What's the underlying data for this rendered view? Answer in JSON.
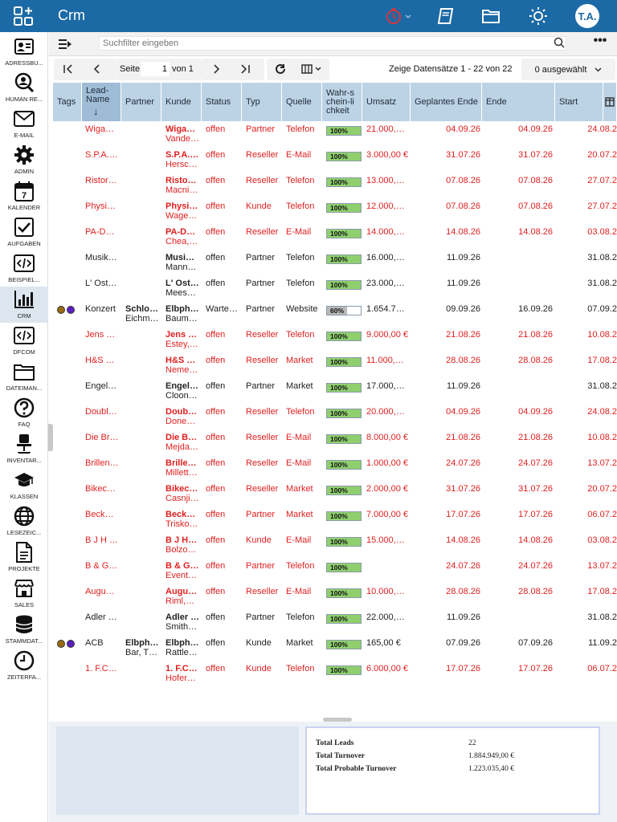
{
  "app": {
    "title": "Crm",
    "user_initials": "T.A."
  },
  "colors": {
    "header_bg": "#1b6aa5",
    "row_red": "#e02020",
    "row_black": "#222222",
    "progress_fill": "#8fcf6e",
    "header_grid": "#bcd3e6"
  },
  "sidebar": [
    {
      "label": "ADRESSBU...",
      "icon": "address-book-icon"
    },
    {
      "label": "HUMAN RE...",
      "icon": "person-search-icon"
    },
    {
      "label": "E-MAIL",
      "icon": "mail-icon"
    },
    {
      "label": "ADMIN",
      "icon": "gear-icon"
    },
    {
      "label": "KALENDER",
      "icon": "calendar-icon"
    },
    {
      "label": "AUFGABEN",
      "icon": "checkbox-icon"
    },
    {
      "label": "BEISPIEL...",
      "icon": "code-icon"
    },
    {
      "label": "CRM",
      "icon": "bar-chart-icon"
    },
    {
      "label": "DFCOM",
      "icon": "code-icon"
    },
    {
      "label": "DATEIMAN...",
      "icon": "folder-icon"
    },
    {
      "label": "FAQ",
      "icon": "question-icon"
    },
    {
      "label": "INVENTAR...",
      "icon": "chair-icon"
    },
    {
      "label": "KLASSEN",
      "icon": "graduation-cap-icon"
    },
    {
      "label": "LESEZEIC...",
      "icon": "globe-icon"
    },
    {
      "label": "PROJEKTE",
      "icon": "document-icon"
    },
    {
      "label": "SALES",
      "icon": "store-icon"
    },
    {
      "label": "STAMMDAT...",
      "icon": "database-icon"
    },
    {
      "label": "ZEITERFA...",
      "icon": "clock-icon"
    }
  ],
  "search": {
    "placeholder": "Suchfilter eingeben"
  },
  "pager": {
    "page_label": "Seite",
    "page_value": "1",
    "of_label": "von 1",
    "records_text": "Zeige Datensätze 1 - 22 von 22",
    "selected_text": "0 ausgewählt"
  },
  "columns": [
    "Tags",
    "Lead-Name",
    "Partner",
    "Kunde",
    "Status",
    "Typ",
    "Quelle",
    "Wahr-schein-lichkeit",
    "Umsatz",
    "Geplantes Ende",
    "Ende",
    "Start"
  ],
  "rows": [
    {
      "red": true,
      "tags": [],
      "lead": "Wiga…",
      "partner": "",
      "kunde1": "Wiga…",
      "kunde2": "Vande…",
      "status": "offen",
      "typ": "Partner",
      "quelle": "Telefon",
      "prob_pct": 100,
      "prob_label": "100%",
      "umsatz": "21.000,…",
      "geplant": "04.09.26",
      "ende": "04.09.26",
      "start": "24.08.2"
    },
    {
      "red": true,
      "tags": [],
      "lead": "S.P.A.…",
      "partner": "",
      "kunde1": "S.P.A.…",
      "kunde2": "Hersc…",
      "status": "offen",
      "typ": "Reseller",
      "quelle": "E-Mail",
      "prob_pct": 100,
      "prob_label": "100%",
      "umsatz": "3.000,00 €",
      "geplant": "31.07.26",
      "ende": "31.07.26",
      "start": "20.07.2"
    },
    {
      "red": true,
      "tags": [],
      "lead": "Ristor…",
      "partner": "",
      "kunde1": "Risto…",
      "kunde2": "Macni…",
      "status": "offen",
      "typ": "Reseller",
      "quelle": "Telefon",
      "prob_pct": 100,
      "prob_label": "100%",
      "umsatz": "13.000,…",
      "geplant": "07.08.26",
      "ende": "07.08.26",
      "start": "27.07.2"
    },
    {
      "red": true,
      "tags": [],
      "lead": "Physi…",
      "partner": "",
      "kunde1": "Physi…",
      "kunde2": "Wage…",
      "status": "offen",
      "typ": "Kunde",
      "quelle": "Telefon",
      "prob_pct": 100,
      "prob_label": "100%",
      "umsatz": "12.000,…",
      "geplant": "07.08.26",
      "ende": "07.08.26",
      "start": "27.07.2"
    },
    {
      "red": true,
      "tags": [],
      "lead": "PA-D…",
      "partner": "",
      "kunde1": "PA-D…",
      "kunde2": "Chea,…",
      "status": "offen",
      "typ": "Reseller",
      "quelle": "E-Mail",
      "prob_pct": 100,
      "prob_label": "100%",
      "umsatz": "14.000,…",
      "geplant": "14.08.26",
      "ende": "14.08.26",
      "start": "03.08.2"
    },
    {
      "red": false,
      "tags": [],
      "lead": "Musik…",
      "partner": "",
      "kunde1": "Musi…",
      "kunde2": "Mann…",
      "status": "offen",
      "typ": "Partner",
      "quelle": "Telefon",
      "prob_pct": 100,
      "prob_label": "100%",
      "umsatz": "16.000,…",
      "geplant": "11.09.26",
      "ende": "",
      "start": "31.08.2"
    },
    {
      "red": false,
      "tags": [],
      "lead": "L' Ost…",
      "partner": "",
      "kunde1": "L' Ost…",
      "kunde2": "Mees…",
      "status": "offen",
      "typ": "Partner",
      "quelle": "Telefon",
      "prob_pct": 100,
      "prob_label": "100%",
      "umsatz": "23.000,…",
      "geplant": "11.09.26",
      "ende": "",
      "start": "31.08.2"
    },
    {
      "red": false,
      "tags": [
        "#9a6a10",
        "#5b1fc0"
      ],
      "lead": "Konzert",
      "partner": "Schlo…",
      "partner2": "Eichm…",
      "kunde1": "Elbph…",
      "kunde2": "Baum…",
      "status": "Warte…",
      "typ": "Partner",
      "quelle": "Website",
      "prob_pct": 60,
      "prob_label": "60%",
      "umsatz": "1.654.7…",
      "geplant": "09.09.26",
      "ende": "16.09.26",
      "start": "07.09.2"
    },
    {
      "red": true,
      "tags": [],
      "lead": "Jens …",
      "partner": "",
      "kunde1": "Jens …",
      "kunde2": "Estey,…",
      "status": "offen",
      "typ": "Reseller",
      "quelle": "Telefon",
      "prob_pct": 100,
      "prob_label": "100%",
      "umsatz": "9.000,00 €",
      "geplant": "21.08.26",
      "ende": "21.08.26",
      "start": "10.08.2"
    },
    {
      "red": true,
      "tags": [],
      "lead": "H&S …",
      "partner": "",
      "kunde1": "H&S …",
      "kunde2": "Neme…",
      "status": "offen",
      "typ": "Reseller",
      "quelle": "Market",
      "prob_pct": 100,
      "prob_label": "100%",
      "umsatz": "11.000,…",
      "geplant": "28.08.26",
      "ende": "28.08.26",
      "start": "17.08.2"
    },
    {
      "red": false,
      "tags": [],
      "lead": "Engel…",
      "partner": "",
      "kunde1": "Engel…",
      "kunde2": "Cloon…",
      "status": "offen",
      "typ": "Partner",
      "quelle": "Market",
      "prob_pct": 100,
      "prob_label": "100%",
      "umsatz": "17.000,…",
      "geplant": "11.09.26",
      "ende": "",
      "start": "31.08.2"
    },
    {
      "red": true,
      "tags": [],
      "lead": "Doubl…",
      "partner": "",
      "kunde1": "Doub…",
      "kunde2": "Done…",
      "status": "offen",
      "typ": "Reseller",
      "quelle": "Telefon",
      "prob_pct": 100,
      "prob_label": "100%",
      "umsatz": "20.000,…",
      "geplant": "04.09.26",
      "ende": "04.09.26",
      "start": "24.08.2"
    },
    {
      "red": true,
      "tags": [],
      "lead": "Die Br…",
      "partner": "",
      "kunde1": "Die B…",
      "kunde2": "Mejda…",
      "status": "offen",
      "typ": "Reseller",
      "quelle": "E-Mail",
      "prob_pct": 100,
      "prob_label": "100%",
      "umsatz": "8.000,00 €",
      "geplant": "21.08.26",
      "ende": "21.08.26",
      "start": "10.08.2"
    },
    {
      "red": true,
      "tags": [],
      "lead": "Brillen…",
      "partner": "",
      "kunde1": "Brille…",
      "kunde2": "Millett…",
      "status": "offen",
      "typ": "Reseller",
      "quelle": "E-Mail",
      "prob_pct": 100,
      "prob_label": "100%",
      "umsatz": "1.000,00 €",
      "geplant": "24.07.26",
      "ende": "24.07.26",
      "start": "13.07.2"
    },
    {
      "red": true,
      "tags": [],
      "lead": "Bikec…",
      "partner": "",
      "kunde1": "Bikec…",
      "kunde2": "Casnji…",
      "status": "offen",
      "typ": "Reseller",
      "quelle": "Market",
      "prob_pct": 100,
      "prob_label": "100%",
      "umsatz": "2.000,00 €",
      "geplant": "31.07.26",
      "ende": "31.07.26",
      "start": "20.07.2"
    },
    {
      "red": true,
      "tags": [],
      "lead": "Beck…",
      "partner": "",
      "kunde1": "Beck…",
      "kunde2": "Trisko…",
      "status": "offen",
      "typ": "Partner",
      "quelle": "Market",
      "prob_pct": 100,
      "prob_label": "100%",
      "umsatz": "7.000,00 €",
      "geplant": "17.07.26",
      "ende": "17.07.26",
      "start": "06.07.2"
    },
    {
      "red": true,
      "tags": [],
      "lead": "B J H …",
      "partner": "",
      "kunde1": "B J H…",
      "kunde2": "Bolzo…",
      "status": "offen",
      "typ": "Kunde",
      "quelle": "E-Mail",
      "prob_pct": 100,
      "prob_label": "100%",
      "umsatz": "15.000,…",
      "geplant": "14.08.26",
      "ende": "14.08.26",
      "start": "03.08.2"
    },
    {
      "red": true,
      "tags": [],
      "lead": "B & G…",
      "partner": "",
      "kunde1": "B & G…",
      "kunde2": "Event…",
      "status": "offen",
      "typ": "Partner",
      "quelle": "Telefon",
      "prob_pct": 100,
      "prob_label": "100%",
      "umsatz": "",
      "geplant": "24.07.26",
      "ende": "24.07.26",
      "start": "13.07.2"
    },
    {
      "red": true,
      "tags": [],
      "lead": "Augu…",
      "partner": "",
      "kunde1": "Augu…",
      "kunde2": "Riml,…",
      "status": "offen",
      "typ": "Reseller",
      "quelle": "E-Mail",
      "prob_pct": 100,
      "prob_label": "100%",
      "umsatz": "10.000,…",
      "geplant": "28.08.26",
      "ende": "28.08.26",
      "start": "17.08.2"
    },
    {
      "red": false,
      "tags": [],
      "lead": "Adler …",
      "partner": "",
      "kunde1": "Adler …",
      "kunde2": "Smith…",
      "status": "offen",
      "typ": "Partner",
      "quelle": "Telefon",
      "prob_pct": 100,
      "prob_label": "100%",
      "umsatz": "22.000,…",
      "geplant": "11.09.26",
      "ende": "",
      "start": "31.08.2"
    },
    {
      "red": false,
      "tags": [
        "#9a6a10",
        "#5b1fc0"
      ],
      "lead": "ACB",
      "partner": "Elbph…",
      "partner2": "Bar, T…",
      "kunde1": "Elbph…",
      "kunde2": "Rattle…",
      "status": "offen",
      "typ": "Kunde",
      "quelle": "Market",
      "prob_pct": 100,
      "prob_label": "100%",
      "umsatz": "165,00 €",
      "geplant": "07.09.26",
      "ende": "07.09.26",
      "start": "11.09.2"
    },
    {
      "red": true,
      "tags": [],
      "lead": "1. F.C…",
      "partner": "",
      "kunde1": "1. F.C…",
      "kunde2": "Hofer…",
      "status": "offen",
      "typ": "Kunde",
      "quelle": "Telefon",
      "prob_pct": 100,
      "prob_label": "100%",
      "umsatz": "6.000,00 €",
      "geplant": "17.07.26",
      "ende": "17.07.26",
      "start": "06.07.2"
    }
  ],
  "summary": {
    "total_leads_label": "Total Leads",
    "total_leads_value": "22",
    "total_turnover_label": "Total Turnover",
    "total_turnover_value": "1.884.949,00 €",
    "total_probable_label": "Total Probable Turnover",
    "total_probable_value": "1.223.035,40 €"
  }
}
